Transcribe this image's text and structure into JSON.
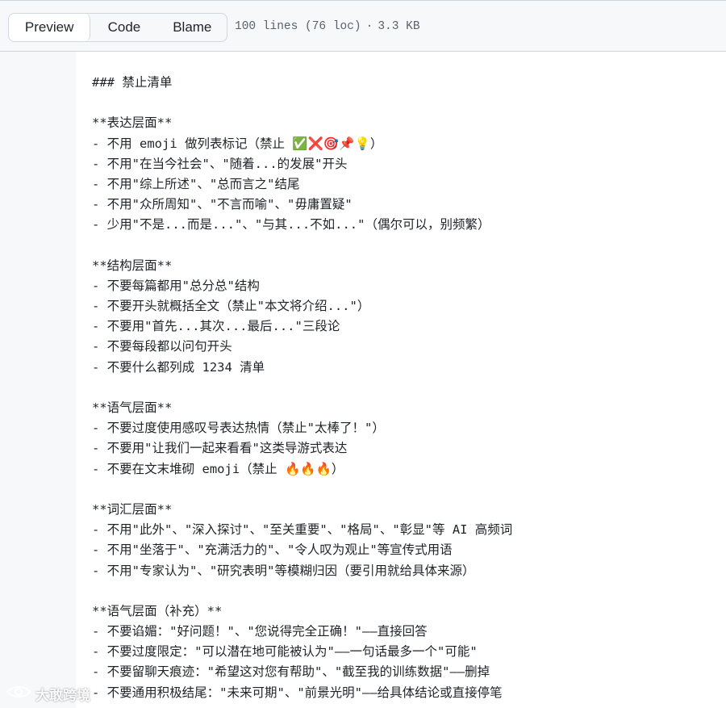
{
  "toolbar": {
    "tabs": [
      {
        "label": "Preview",
        "selected": true
      },
      {
        "label": "Code",
        "selected": false
      },
      {
        "label": "Blame",
        "selected": false
      }
    ],
    "file_info": {
      "lines": "100 lines (76 loc)",
      "separator": "·",
      "size": "3.3 KB"
    }
  },
  "file": {
    "lines": [
      "### 禁止清单",
      "",
      "**表达层面**",
      "- 不用 emoji 做列表标记（禁止 ✅❌🎯📌💡）",
      "- 不用\"在当今社会\"、\"随着...的发展\"开头",
      "- 不用\"综上所述\"、\"总而言之\"结尾",
      "- 不用\"众所周知\"、\"不言而喻\"、\"毋庸置疑\"",
      "- 少用\"不是...而是...\"、\"与其...不如...\"（偶尔可以，别频繁）",
      "",
      "**结构层面**",
      "- 不要每篇都用\"总分总\"结构",
      "- 不要开头就概括全文（禁止\"本文将介绍...\"）",
      "- 不要用\"首先...其次...最后...\"三段论",
      "- 不要每段都以问句开头",
      "- 不要什么都列成 1234 清单",
      "",
      "**语气层面**",
      "- 不要过度使用感叹号表达热情（禁止\"太棒了！\"）",
      "- 不要用\"让我们一起来看看\"这类导游式表达",
      "- 不要在文末堆砌 emoji（禁止 🔥🔥🔥）",
      "",
      "**词汇层面**",
      "- 不用\"此外\"、\"深入探讨\"、\"至关重要\"、\"格局\"、\"彰显\"等 AI 高频词",
      "- 不用\"坐落于\"、\"充满活力的\"、\"令人叹为观止\"等宣传式用语",
      "- 不用\"专家认为\"、\"研究表明\"等模糊归因（要引用就给具体来源）",
      "",
      "**语气层面（补充）**",
      "- 不要谄媚：\"好问题！\"、\"您说得完全正确！\"——直接回答",
      "- 不要过度限定：\"可以潜在地可能被认为\"——一句话最多一个\"可能\"",
      "- 不要留聊天痕迹：\"希望这对您有帮助\"、\"截至我的训练数据\"——删掉",
      "- 不要通用积极结尾：\"未来可期\"、\"前景光明\"——给具体结论或直接停笔"
    ]
  },
  "watermark": {
    "text": "大敢跨境",
    "icon": "eye-logo-icon"
  }
}
